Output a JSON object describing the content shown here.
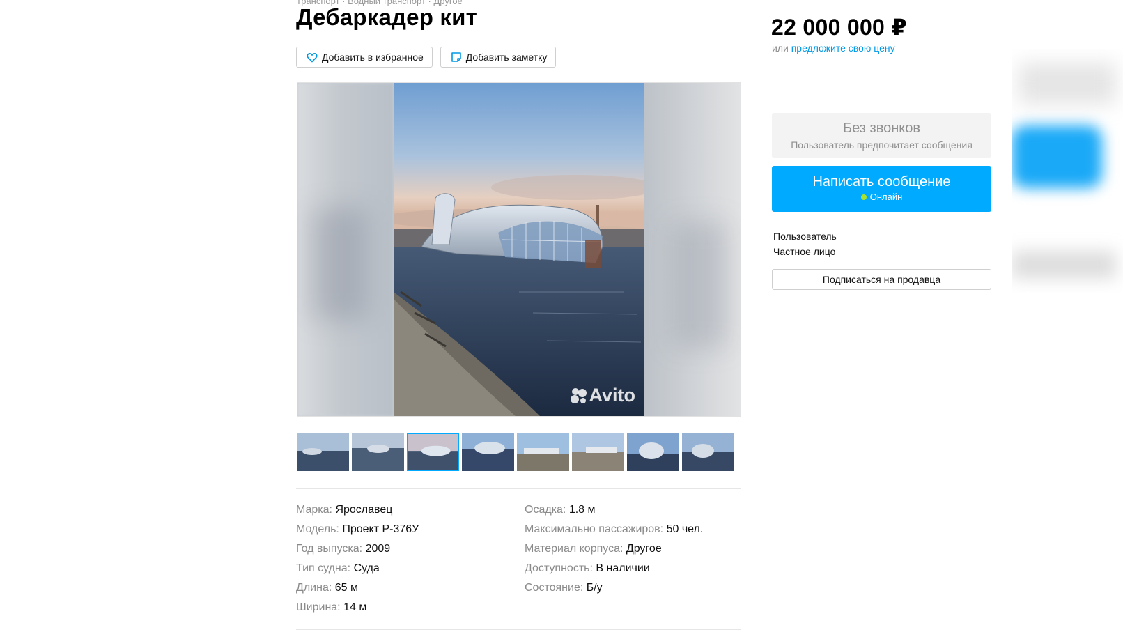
{
  "breadcrumb": "Транспорт · Водный транспорт · Другое",
  "listing": {
    "title": "Дебаркадер кит",
    "favorite_label": "Добавить в избранное",
    "note_label": "Добавить заметку",
    "watermark": "Avito"
  },
  "gallery": {
    "thumbnail_count": 8,
    "active_index": 3
  },
  "params": {
    "left": [
      {
        "label": "Марка:",
        "value": "Ярославец"
      },
      {
        "label": "Модель:",
        "value": "Проект Р-376У"
      },
      {
        "label": "Год выпуска:",
        "value": "2009"
      },
      {
        "label": "Тип судна:",
        "value": "Суда"
      },
      {
        "label": "Длина:",
        "value": "65 м"
      },
      {
        "label": "Ширина:",
        "value": "14 м"
      }
    ],
    "right": [
      {
        "label": "Осадка:",
        "value": "1.8 м"
      },
      {
        "label": "Максимально пассажиров:",
        "value": "50 чел."
      },
      {
        "label": "Материал корпуса:",
        "value": "Другое"
      },
      {
        "label": "Доступность:",
        "value": "В наличии"
      },
      {
        "label": "Состояние:",
        "value": "Б/у"
      }
    ]
  },
  "sidebar": {
    "price": "22 000 000 ₽",
    "price_or": "или",
    "offer_price_link": "предложите свою цену",
    "no_calls_title": "Без звонков",
    "no_calls_sub": "Пользователь предпочитает сообщения",
    "message_button": "Написать сообщение",
    "online_status": "Онлайн",
    "seller_name": "Пользователь",
    "seller_type": "Частное лицо",
    "subscribe_button": "Подписаться на продавца"
  },
  "colors": {
    "accent": "#00aaff",
    "link": "#0099e5",
    "online_dot": "#a6e22e",
    "muted_text": "#8a8a8a"
  },
  "icons": {
    "favorite": "heart-icon",
    "note": "note-icon"
  }
}
